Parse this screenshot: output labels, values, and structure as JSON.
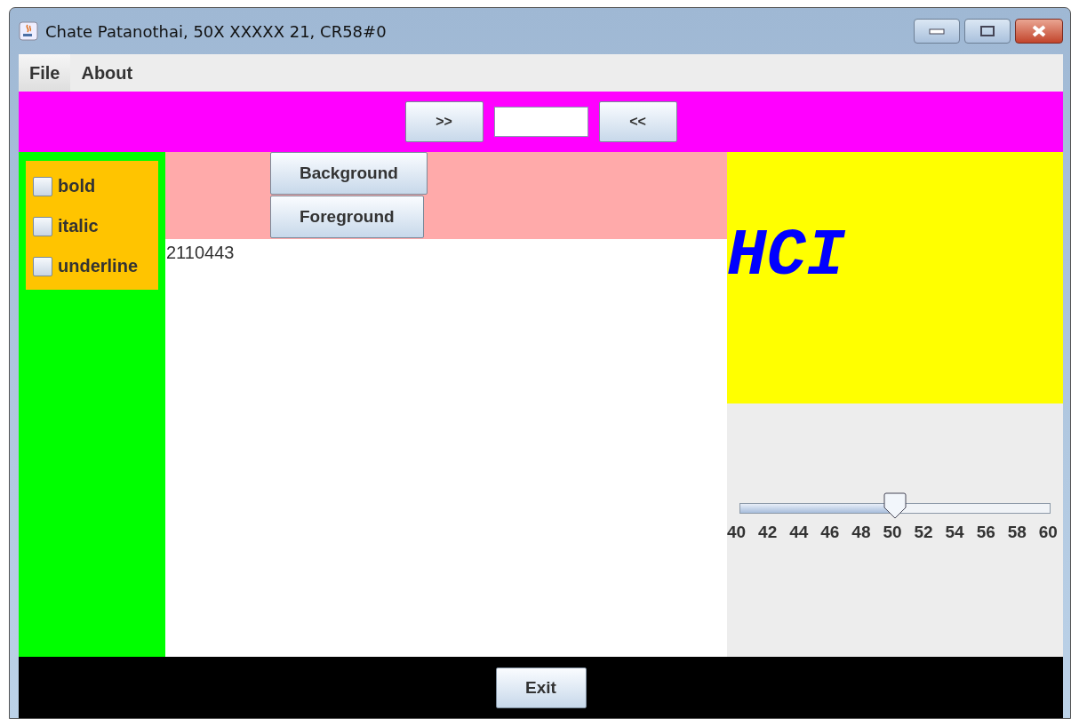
{
  "window": {
    "title": "Chate Patanothai, 50X XXXXX 21, CR58#0"
  },
  "menu": [
    {
      "label": "File",
      "selected": true
    },
    {
      "label": "About",
      "selected": false
    }
  ],
  "toolbar": {
    "next": ">>",
    "prev": "<<"
  },
  "styles": [
    {
      "label": "bold",
      "checked": false
    },
    {
      "label": "italic",
      "checked": false
    },
    {
      "label": "underline",
      "checked": false
    }
  ],
  "color_buttons": [
    "Background",
    "Foreground"
  ],
  "text_area": "2110443",
  "preview": "HCI",
  "slider": {
    "level": 0.5,
    "labels": [
      "40",
      "42",
      "44",
      "46",
      "48",
      "50",
      "52",
      "54",
      "56",
      "58",
      "60"
    ]
  },
  "exit": "Exit"
}
